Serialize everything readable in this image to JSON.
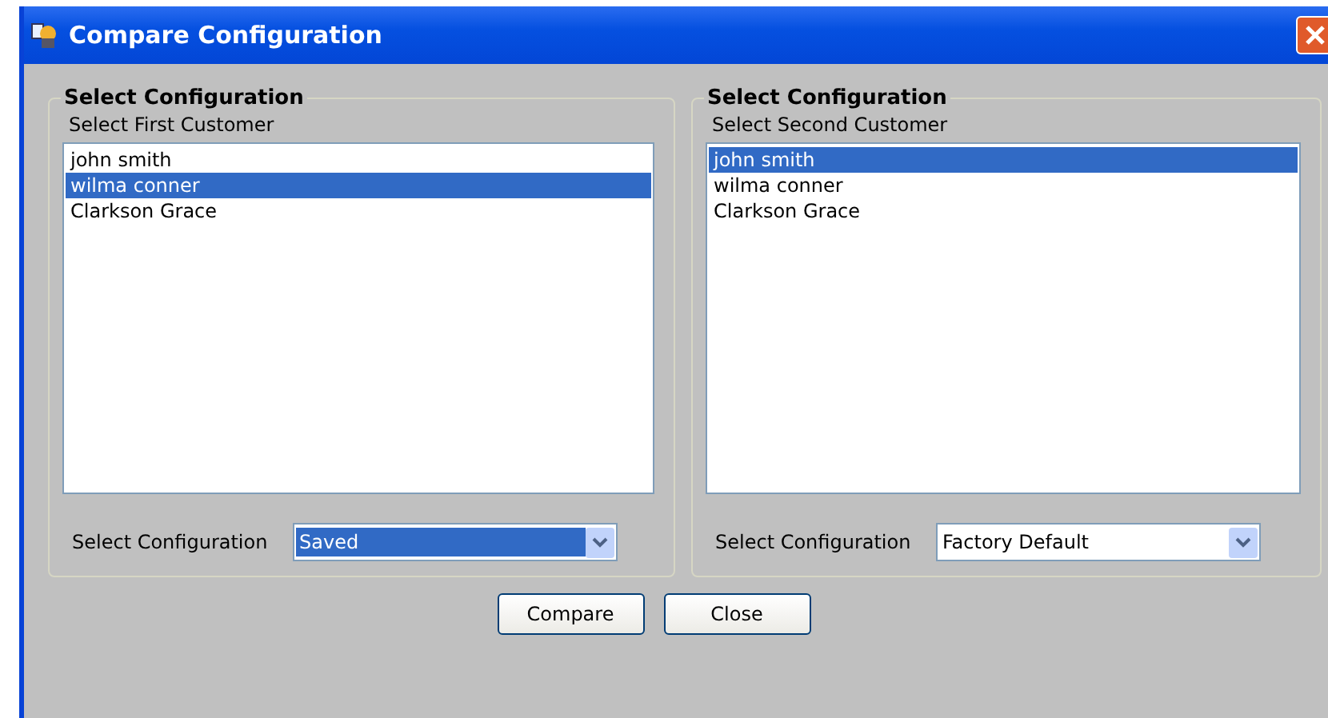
{
  "window": {
    "title": "Compare Configuration"
  },
  "panels": [
    {
      "title": "Select Configuration",
      "list_label": "Select First Customer",
      "customers": [
        {
          "name": "john smith",
          "selected": false
        },
        {
          "name": "wilma conner",
          "selected": true
        },
        {
          "name": "Clarkson Grace",
          "selected": false
        }
      ],
      "combo_label": "Select Configuration",
      "combo_value": "Saved",
      "combo_focused": true
    },
    {
      "title": "Select Configuration",
      "list_label": "Select Second Customer",
      "customers": [
        {
          "name": "john smith",
          "selected": true
        },
        {
          "name": "wilma conner",
          "selected": false
        },
        {
          "name": "Clarkson Grace",
          "selected": false
        }
      ],
      "combo_label": "Select Configuration",
      "combo_value": "Factory Default",
      "combo_focused": false
    }
  ],
  "buttons": [
    "Compare",
    "Close"
  ]
}
